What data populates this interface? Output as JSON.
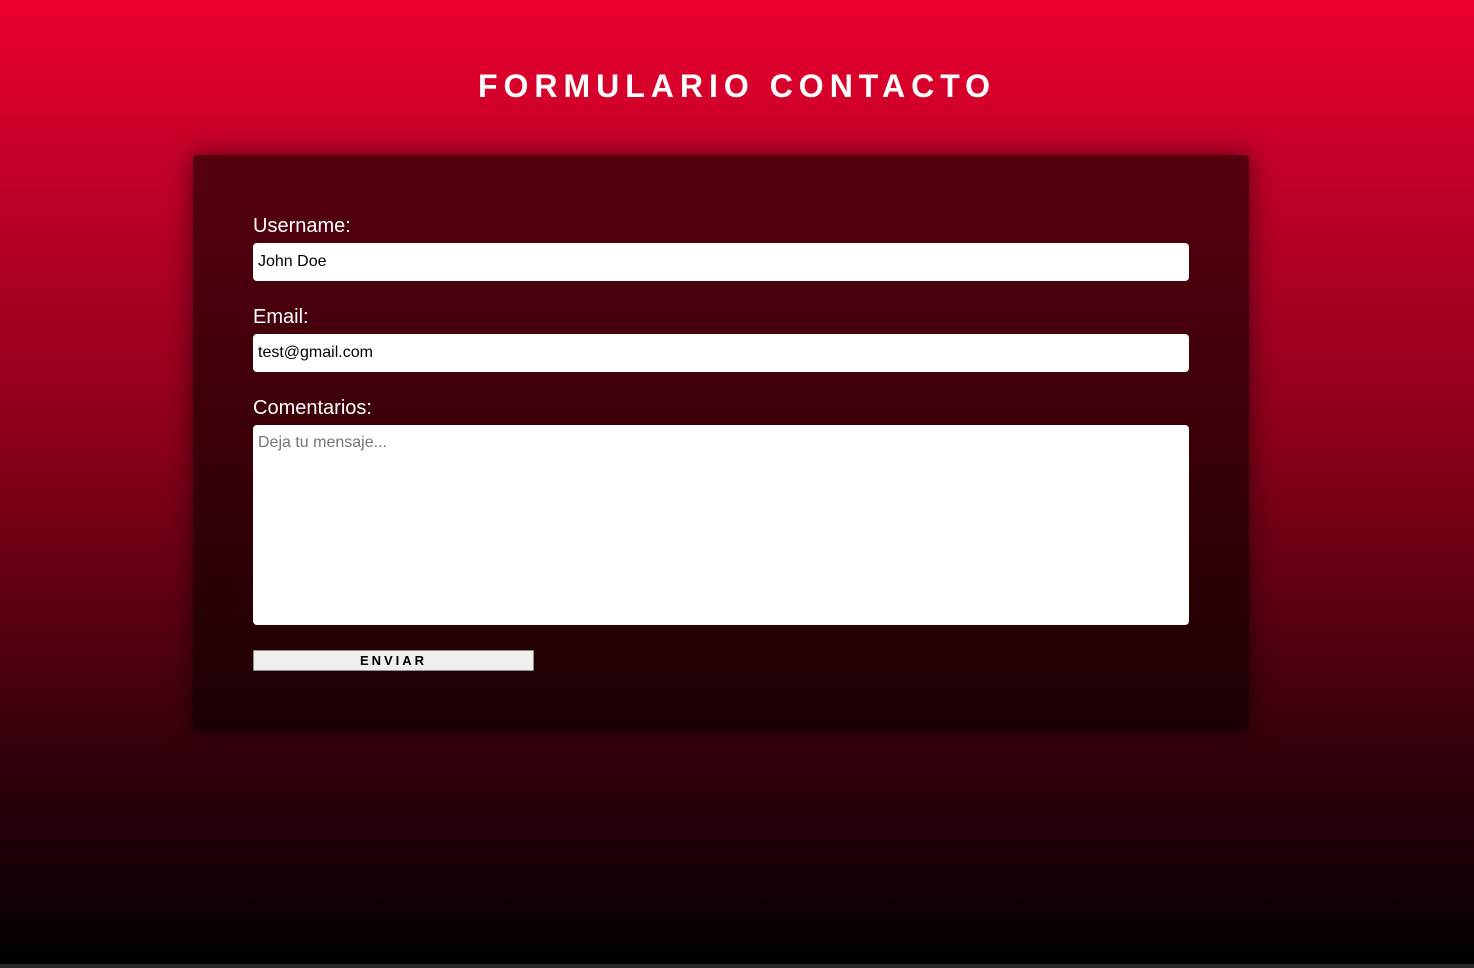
{
  "page": {
    "title": "FORMULARIO CONTACTO"
  },
  "form": {
    "username": {
      "label": "Username:",
      "value": "John Doe"
    },
    "email": {
      "label": "Email:",
      "value": "test@gmail.com"
    },
    "comments": {
      "label": "Comentarios:",
      "placeholder": "Deja tu mensaje..."
    },
    "submit_label": "ENVIAR"
  },
  "colors": {
    "background_top": "#ee002d",
    "background_bottom": "#000000",
    "card": "#3a0008",
    "text": "#ffffff"
  }
}
